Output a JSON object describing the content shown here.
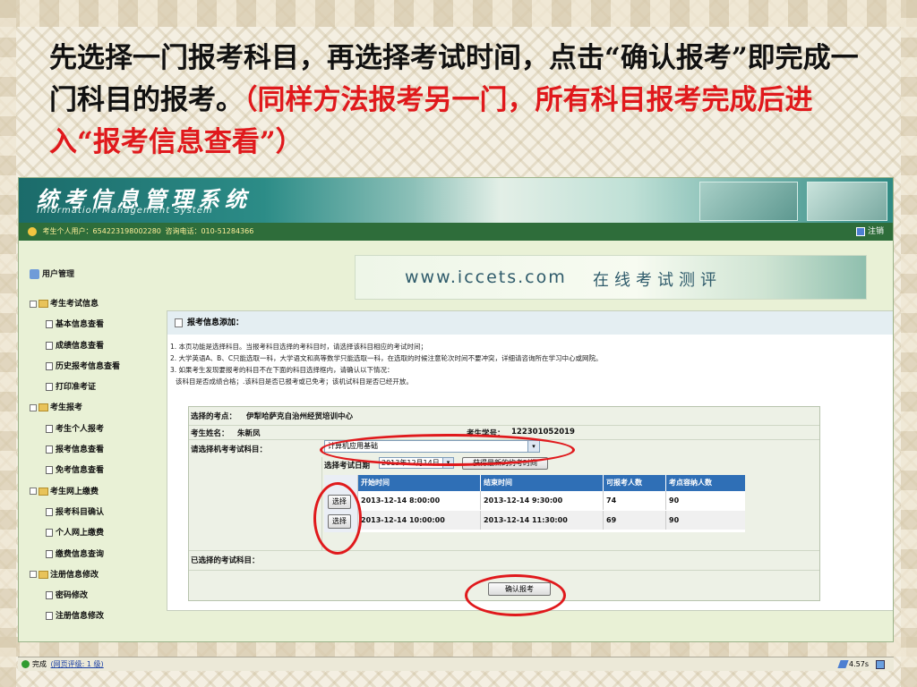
{
  "slide": {
    "title_part1": "先选择一门报考科目，再选择考试时间，点击“确认报考”即完成一门科目的报考。",
    "title_part2": "（同样方法报考另一门，所有科目报考完成后进入“报考信息查看”）"
  },
  "banner": {
    "title": "统考信息管理系统",
    "subtitle": "Information  Management  System"
  },
  "userbar": {
    "user_text": "考生个人用户：654223198002280",
    "hotline": "咨询电话：010-51284366",
    "logout": "注销"
  },
  "site_banner": {
    "url": "www.iccets.com",
    "slogan": "在线考试测评"
  },
  "sidebar": {
    "title": "用户管理",
    "groups": [
      {
        "label": "考生考试信息",
        "items": [
          "基本信息查看",
          "成绩信息查看",
          "历史报考信息查看",
          "打印准考证"
        ]
      },
      {
        "label": "考生报考",
        "items": [
          "考生个人报考",
          "报考信息查看",
          "免考信息查看"
        ]
      },
      {
        "label": "考生网上缴费",
        "items": [
          "报考科目确认",
          "个人网上缴费",
          "缴费信息查询"
        ]
      },
      {
        "label": "注册信息修改",
        "items": [
          "密码修改",
          "注册信息修改"
        ]
      }
    ]
  },
  "content": {
    "header": "报考信息添加：",
    "notes": [
      "1. 本页功能是选择科目。当报考科目选择的考科目时，请选择该科目相应的考试时间；",
      "2. 大学英语A、B、C只能选取一科，大学语文和高等数学只能选取一科，在选取的时候注意轮次时间不要冲突，详细请咨询所在学习中心或网院。",
      "3. 如果考生发现要报考的科目不在下面的科目选择框内，请确认以下情况：",
      "   该科目是否成绩合格；.该科目是否已报考或已免考；该机试科目是否已经开放。"
    ],
    "exam_site_label": "选择的考点：",
    "exam_site": "伊犁哈萨克自治州经贸培训中心",
    "name_label": "考生姓名：",
    "name": "朱新凤",
    "student_no_label": "考生学号：",
    "student_no": "122301052019",
    "subject_label": "请选择机考考试科目：",
    "subject_value": "计算机应用基础",
    "date_label": "选择考试日期",
    "date_value": "2013年12月14日",
    "refresh_button": "获得最新的约考时间",
    "table_headers": [
      "开始时间",
      "结束时间",
      "可报考人数",
      "考点容纳人数"
    ],
    "rows": [
      {
        "select": "选择",
        "start": "2013-12-14 8:00:00",
        "end": "2013-12-14 9:30:00",
        "available": "74",
        "capacity": "90"
      },
      {
        "select": "选择",
        "start": "2013-12-14 10:00:00",
        "end": "2013-12-14 11:30:00",
        "available": "69",
        "capacity": "90"
      }
    ],
    "selected_label": "已选择的考试科目：",
    "confirm_button": "确认报考"
  },
  "statusbar": {
    "status": "完成",
    "rating": "(网页评级: 1 级)",
    "time": "4.57s"
  },
  "colors": {
    "highlight_red": "#e0191c",
    "banner_teal": "#1b6b6a",
    "userbar_green": "#2e6d3a",
    "table_header_blue": "#2f6fb6"
  }
}
